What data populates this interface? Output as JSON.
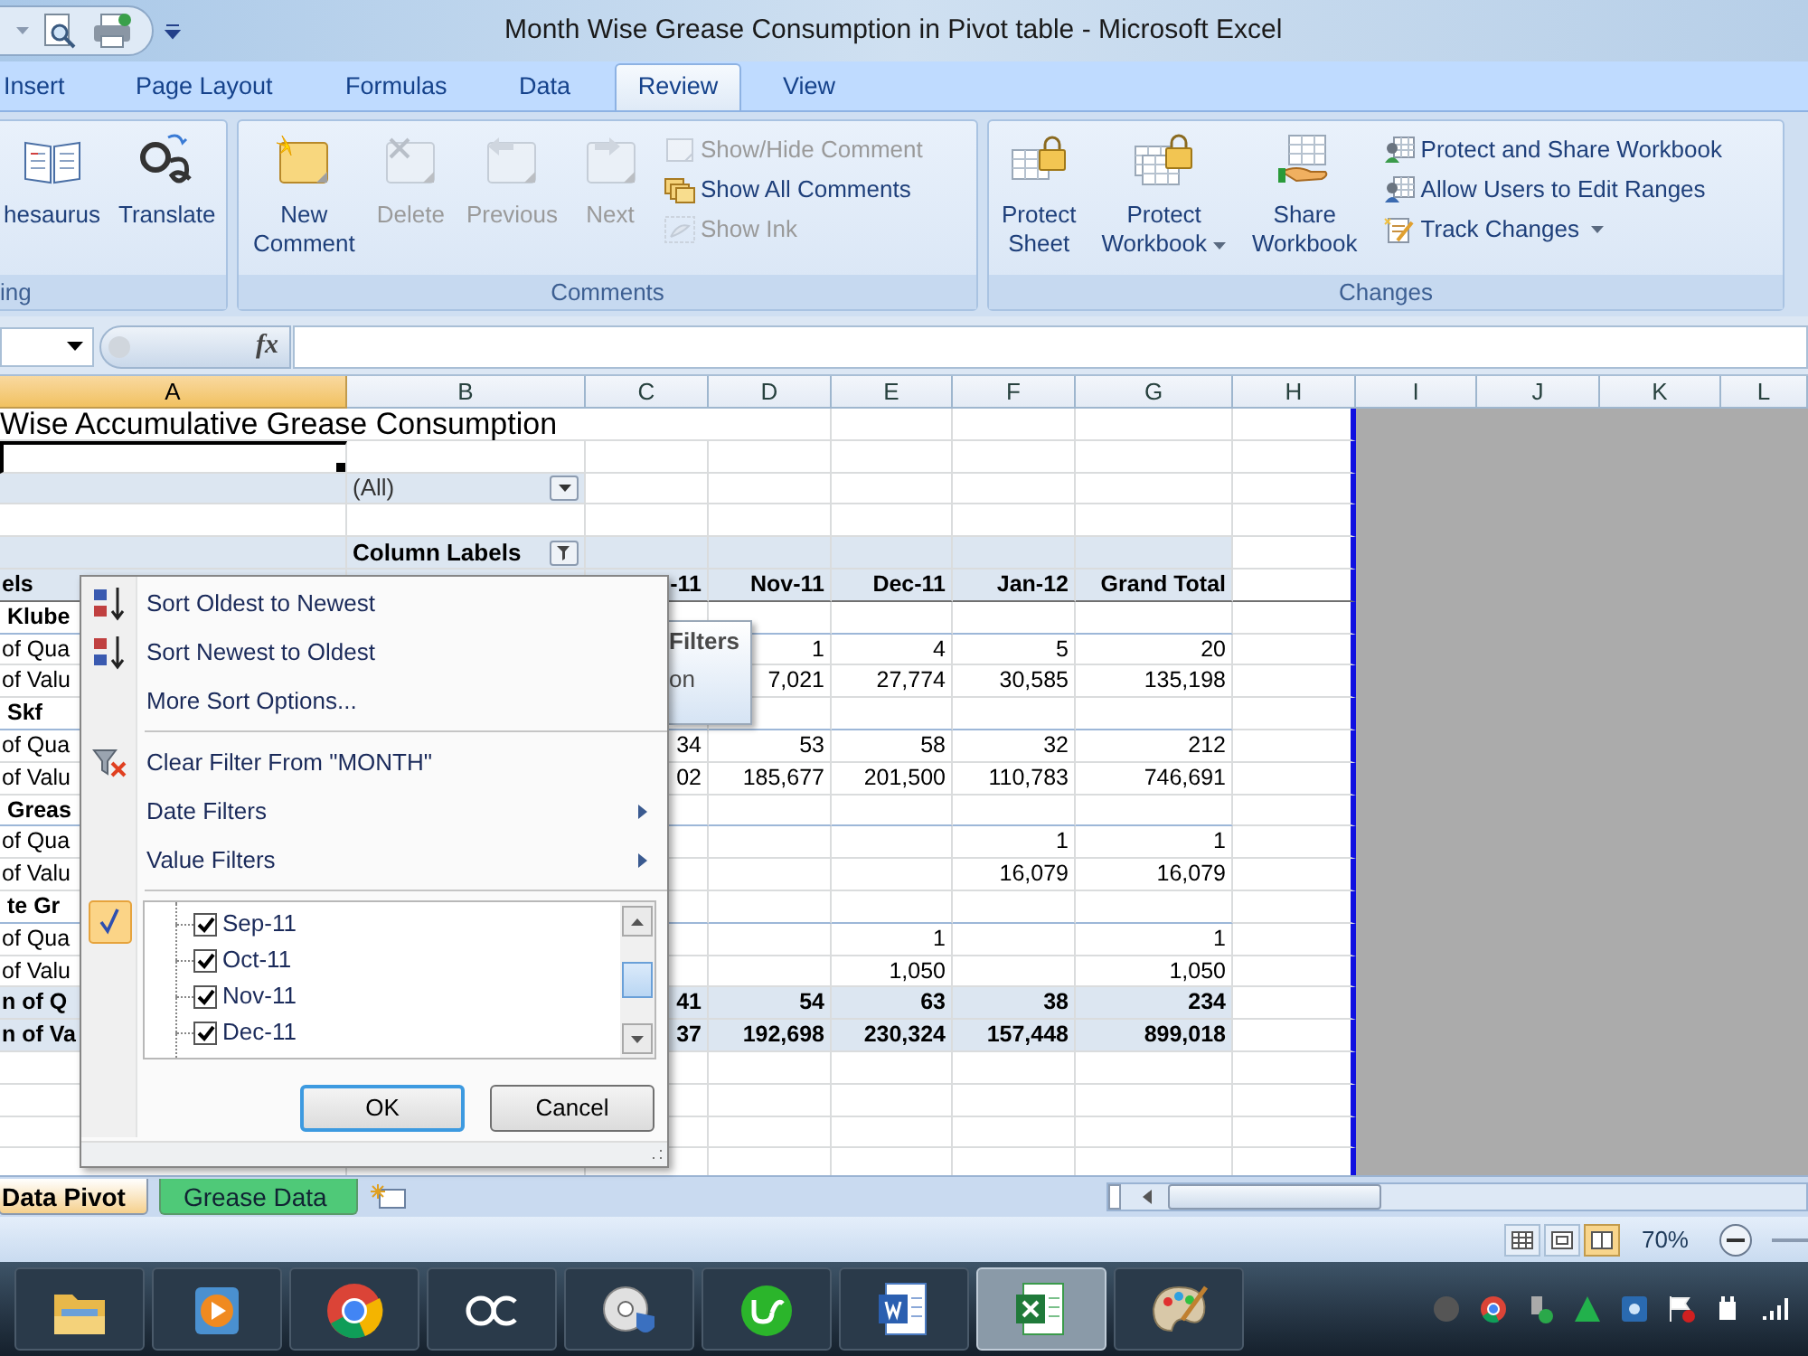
{
  "window": {
    "title": "Month Wise Grease Consumption in Pivot table - Microsoft Excel"
  },
  "ribbon_tabs": [
    {
      "label": "Insert",
      "selected": false
    },
    {
      "label": "Page Layout",
      "selected": false
    },
    {
      "label": "Formulas",
      "selected": false
    },
    {
      "label": "Data",
      "selected": false
    },
    {
      "label": "Review",
      "selected": true
    },
    {
      "label": "View",
      "selected": false
    }
  ],
  "ribbon_groups": [
    {
      "label": "ing",
      "large_buttons": [
        {
          "lines": [
            "hesaurus"
          ],
          "disabled": false
        },
        {
          "lines": [
            "Translate"
          ],
          "disabled": false
        }
      ]
    },
    {
      "label": "Comments",
      "large_buttons": [
        {
          "lines": [
            "New",
            "Comment"
          ],
          "disabled": false
        },
        {
          "lines": [
            "Delete"
          ],
          "disabled": true
        },
        {
          "lines": [
            "Previous"
          ],
          "disabled": true
        },
        {
          "lines": [
            "Next"
          ],
          "disabled": true
        }
      ],
      "small_buttons": [
        {
          "label": "Show/Hide Comment",
          "disabled": true
        },
        {
          "label": "Show All Comments",
          "disabled": false
        },
        {
          "label": "Show Ink",
          "disabled": true
        }
      ]
    },
    {
      "label": "Changes",
      "large_buttons": [
        {
          "lines": [
            "Protect",
            "Sheet"
          ],
          "disabled": false
        },
        {
          "lines": [
            "Protect",
            "Workbook"
          ],
          "disabled": false,
          "dropdown": true
        },
        {
          "lines": [
            "Share",
            "Workbook"
          ],
          "disabled": false
        }
      ],
      "small_buttons": [
        {
          "label": "Protect and Share Workbook",
          "disabled": false
        },
        {
          "label": "Allow Users to Edit Ranges",
          "disabled": false
        },
        {
          "label": "Track Changes",
          "disabled": false,
          "dropdown": true
        }
      ]
    }
  ],
  "formula_bar": {
    "function_label": "fx"
  },
  "columns": [
    {
      "label": "A",
      "selected": true
    },
    {
      "label": "B",
      "selected": false
    },
    {
      "label": "C",
      "selected": false
    },
    {
      "label": "D",
      "selected": false
    },
    {
      "label": "E",
      "selected": false
    },
    {
      "label": "F",
      "selected": false
    },
    {
      "label": "G",
      "selected": false
    },
    {
      "label": "H",
      "selected": false
    },
    {
      "label": "I",
      "selected": false
    },
    {
      "label": "J",
      "selected": false
    },
    {
      "label": "K",
      "selected": false
    },
    {
      "label": "L",
      "selected": false
    }
  ],
  "rows": [
    {
      "kind": "title",
      "active": false,
      "A": "Wise Accumulative Grease Consumption"
    },
    {
      "kind": "blank",
      "active": true
    },
    {
      "kind": "page_field",
      "active": false,
      "B": "(All)"
    },
    {
      "kind": "blank",
      "active": false
    },
    {
      "kind": "column_labels",
      "active": false,
      "B": "Column Labels"
    },
    {
      "kind": "header",
      "active": false,
      "A": "els",
      "C": "-11",
      "D": "Nov-11",
      "E": "Dec-11",
      "F": "Jan-12",
      "G": "Grand Total"
    },
    {
      "kind": "group",
      "active": false,
      "A": "Klube"
    },
    {
      "kind": "value",
      "active": false,
      "A": "of Qua",
      "D": "1",
      "E": "4",
      "F": "5",
      "G": "20"
    },
    {
      "kind": "value",
      "active": false,
      "A": "of Valu",
      "D": "7,021",
      "E": "27,774",
      "F": "30,585",
      "G": "135,198"
    },
    {
      "kind": "group",
      "active": false,
      "A": "Skf"
    },
    {
      "kind": "value",
      "active": false,
      "A": "of Qua",
      "C": "34",
      "D": "53",
      "E": "58",
      "F": "32",
      "G": "212"
    },
    {
      "kind": "value",
      "active": false,
      "A": "of Valu",
      "C": "02",
      "D": "185,677",
      "E": "201,500",
      "F": "110,783",
      "G": "746,691"
    },
    {
      "kind": "group",
      "active": false,
      "A": "Greas"
    },
    {
      "kind": "value",
      "active": false,
      "A": "of Qua",
      "F": "1",
      "G": "1"
    },
    {
      "kind": "value",
      "active": false,
      "A": "of Valu",
      "F": "16,079",
      "G": "16,079"
    },
    {
      "kind": "group",
      "active": false,
      "A": "te Gr"
    },
    {
      "kind": "value",
      "active": false,
      "A": "of Qua",
      "E": "1",
      "G": "1"
    },
    {
      "kind": "value",
      "active": false,
      "A": "of Valu",
      "E": "1,050",
      "G": "1,050"
    },
    {
      "kind": "total",
      "active": false,
      "A": "n of Q",
      "C": "41",
      "D": "54",
      "E": "63",
      "F": "38",
      "G": "234"
    },
    {
      "kind": "total",
      "active": false,
      "A": "n of Va",
      "C": "37",
      "D": "192,698",
      "E": "230,324",
      "F": "157,448",
      "G": "899,018"
    }
  ],
  "tooltip": {
    "lines": [
      "Filters",
      "on"
    ]
  },
  "filter_menu": {
    "items": [
      {
        "kind": "sort_asc",
        "label": "Sort Oldest to Newest"
      },
      {
        "kind": "sort_desc",
        "label": "Sort Newest to Oldest"
      },
      {
        "kind": "plain",
        "label": "More Sort Options..."
      },
      {
        "kind": "separator"
      },
      {
        "kind": "clear_filter",
        "label": "Clear Filter From \"MONTH\""
      },
      {
        "kind": "submenu",
        "label": "Date Filters"
      },
      {
        "kind": "submenu",
        "label": "Value Filters"
      },
      {
        "kind": "separator"
      }
    ],
    "list": [
      {
        "label": "Sep-11",
        "checked": true
      },
      {
        "label": "Oct-11",
        "checked": true
      },
      {
        "label": "Nov-11",
        "checked": true
      },
      {
        "label": "Dec-11",
        "checked": true
      }
    ],
    "buttons": [
      "OK",
      "Cancel"
    ]
  },
  "sheet_tabs": [
    {
      "label": "Data Pivot",
      "selected": true
    },
    {
      "label": "Grease Data",
      "selected": false,
      "color": "#4fc978"
    }
  ],
  "status_bar": {
    "views": [
      {
        "selected": false
      },
      {
        "selected": false
      },
      {
        "selected": true
      }
    ],
    "zoom": "70%"
  },
  "taskbar": {
    "apps": [
      {
        "selected": false
      },
      {
        "selected": false
      },
      {
        "selected": false
      },
      {
        "selected": false
      },
      {
        "selected": false
      },
      {
        "selected": false
      },
      {
        "selected": false
      },
      {
        "selected": true
      },
      {
        "selected": false
      }
    ]
  }
}
